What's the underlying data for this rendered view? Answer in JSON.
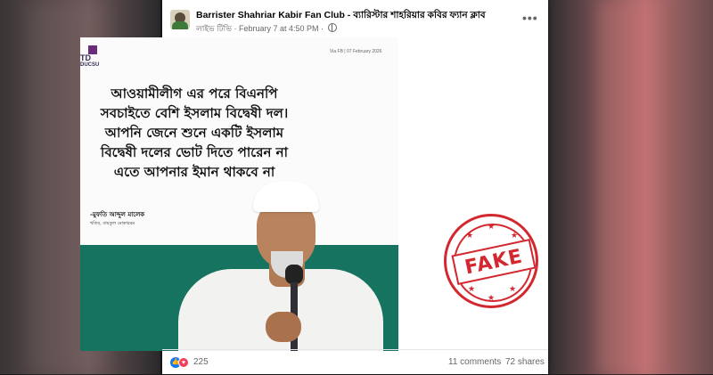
{
  "post": {
    "page_name": "Barrister Shahriar Kabir Fan Club - ব্যারিস্টার শাহরিয়ার কবির ফ্যান ক্লাব",
    "author_line": "লাইভ টিভি",
    "timestamp": "February 7 at 4:50 PM",
    "more_label": "•••"
  },
  "image": {
    "logo_line1": "TD",
    "logo_line2": "DUCSU",
    "date_tag": "Via FB | 07 February 2026",
    "quote_lines": [
      "আওয়ামীলীগ এর পরে বিএনপি",
      "সবচাইতে বেশি ইসলাম বিদ্বেষী দল।",
      "আপনি জেনে শুনে একটি ইসলাম",
      "বিদ্বেষী দলের ভোট দিতে পারেন না",
      "এতে আপনার ইমান থাকবে না"
    ],
    "author": "-মুফতি আব্দুল মালেক",
    "author_title": "খতিব, বায়তুল মোকাররম",
    "stamp_text": "FAKE"
  },
  "footer": {
    "reaction_count": "225",
    "comments": "11 comments",
    "shares": "72 shares"
  },
  "colors": {
    "stamp": "#d3282f",
    "band": "#16735f",
    "like": "#1877f2",
    "love": "#f33e58"
  }
}
